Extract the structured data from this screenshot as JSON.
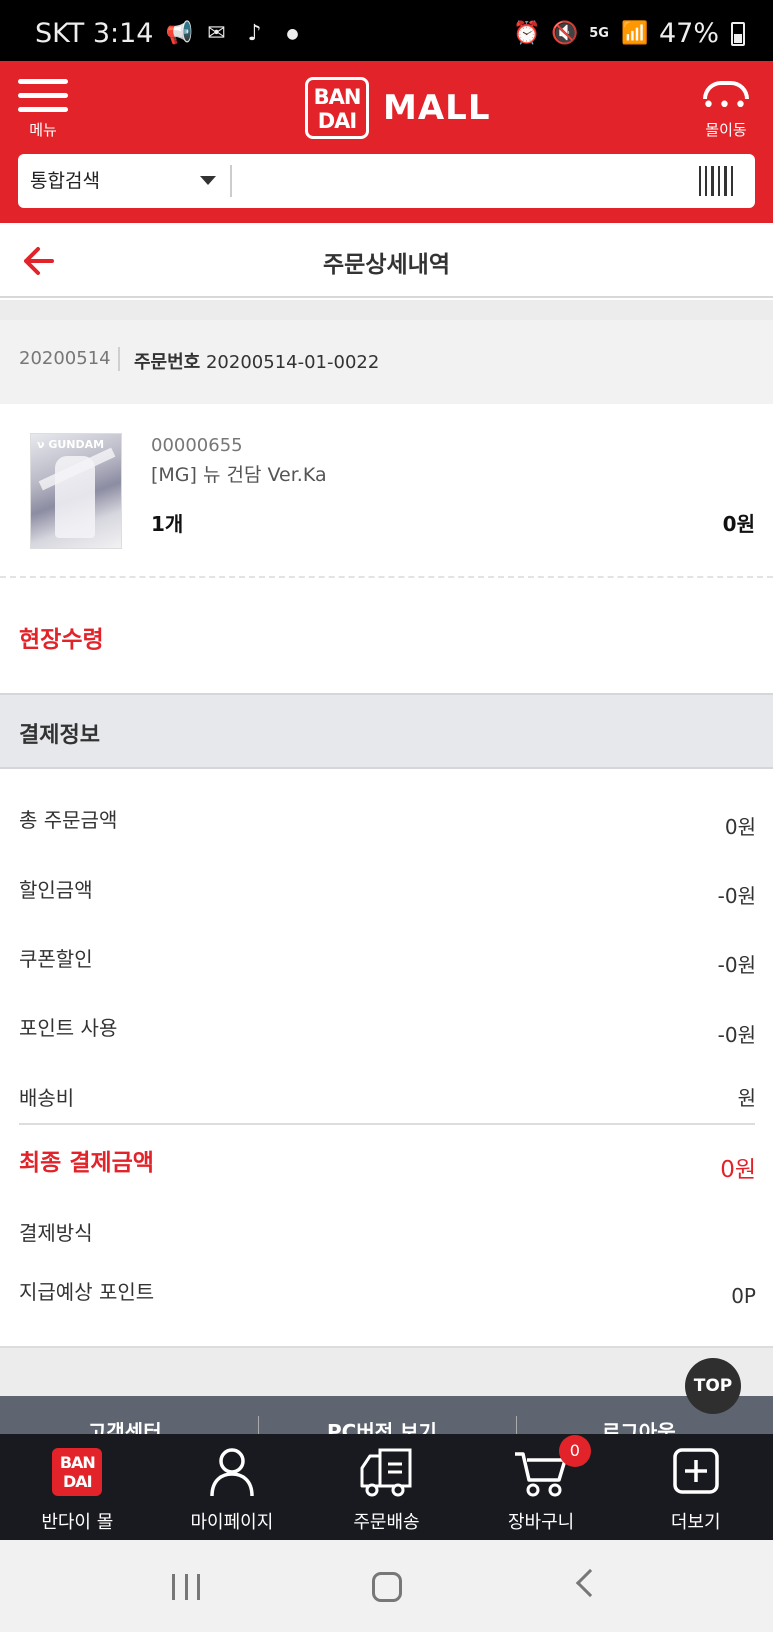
{
  "status_bar": {
    "carrier_time": "SKT 3:14",
    "battery": "47%",
    "network": "5G"
  },
  "header": {
    "menu_label": "메뉴",
    "logo_box": "BAN DAI",
    "logo_text": "MALL",
    "mall_move_label": "몰이동",
    "search": {
      "select_value": "통합검색",
      "placeholder": ""
    }
  },
  "title_bar": {
    "title": "주문상세내역"
  },
  "order": {
    "date": "20200514",
    "number_label": "주문번호",
    "number": "20200514-01-0022"
  },
  "product": {
    "code": "00000655",
    "name": "[MG] 뉴 건담 Ver.Ka",
    "quantity": "1개",
    "price": "0원",
    "thumb_text": "ν GUNDAM"
  },
  "pickup": "현장수령",
  "payment": {
    "header": "결제정보",
    "rows": [
      {
        "label": "총 주문금액",
        "value": "0원"
      },
      {
        "label": "할인금액",
        "value": "-0원"
      },
      {
        "label": "쿠폰할인",
        "value": "-0원"
      },
      {
        "label": "포인트 사용",
        "value": "-0원"
      },
      {
        "label": "배송비",
        "value": "원"
      }
    ],
    "final_label": "최종 결제금액",
    "final_value": "0원",
    "method_label": "결제방식",
    "method_value": "",
    "points_label": "지급예상 포인트",
    "points_value": "0P"
  },
  "footer_links": [
    "고객센터",
    "PC버전 보기",
    "로그아웃"
  ],
  "top_button": "TOP",
  "bottom_nav": [
    {
      "label": "반다이 몰",
      "icon": "bandai-logo-icon"
    },
    {
      "label": "마이페이지",
      "icon": "person-icon"
    },
    {
      "label": "주문배송",
      "icon": "truck-icon"
    },
    {
      "label": "장바구니",
      "icon": "cart-icon",
      "badge": "0"
    },
    {
      "label": "더보기",
      "icon": "plus-square-icon"
    }
  ],
  "colors": {
    "brand_red": "#e2232a",
    "nav_dark": "#191a1f"
  }
}
